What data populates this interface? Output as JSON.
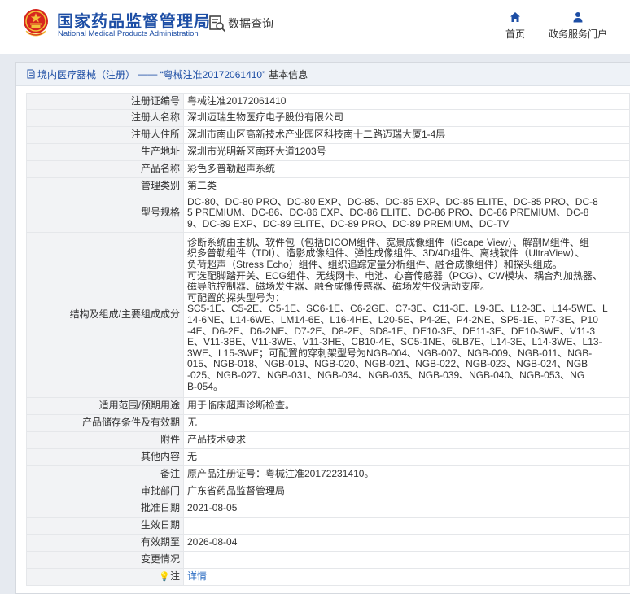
{
  "header": {
    "brand_cn": "国家药品监督管理局",
    "brand_en": "National Medical Products Administration",
    "data_query": "数据查询",
    "nav": [
      {
        "label": "首页",
        "icon": "home-icon"
      },
      {
        "label": "政务服务门户",
        "icon": "user-icon"
      }
    ]
  },
  "panel": {
    "breadcrumb_link": "境内医疗器械（注册）",
    "breadcrumb_sep": " —— ",
    "breadcrumb_item": "“粤械注准20172061410”",
    "breadcrumb_suffix": "基本信息"
  },
  "fields": {
    "reg_no": {
      "label": "注册证编号",
      "value": "粤械注准20172061410"
    },
    "registrant": {
      "label": "注册人名称",
      "value": "深圳迈瑞生物医疗电子股份有限公司"
    },
    "registrant_addr": {
      "label": "注册人住所",
      "value": "深圳市南山区高新技术产业园区科技南十二路迈瑞大厦1-4层"
    },
    "production_addr": {
      "label": "生产地址",
      "value": "深圳市光明新区南环大道1203号"
    },
    "product_name": {
      "label": "产品名称",
      "value": "彩色多普勒超声系统"
    },
    "mgmt_class": {
      "label": "管理类别",
      "value": "第二类"
    },
    "model_spec": {
      "label": "型号规格",
      "lines": [
        "DC-80、DC-80 PRO、DC-80 EXP、DC-85、DC-85 EXP、DC-85 ELITE、DC-85 PRO、DC-8",
        "5 PREMIUM、DC-86、DC-86 EXP、DC-86 ELITE、DC-86 PRO、DC-86 PREMIUM、DC-8",
        "9、DC-89 EXP、DC-89 ELITE、DC-89 PRO、DC-89 PREMIUM、DC-TV"
      ]
    },
    "structure": {
      "label": "结构及组成/主要组成成分",
      "lines": [
        "诊断系统由主机、软件包（包括DICOM组件、宽景成像组件（iScape View）、解剖M组件、组",
        "织多普勒组件（TDI）、造影成像组件、弹性成像组件、3D/4D组件、离线软件（UltraView）、",
        "负荷超声（Stress Echo）组件、组织追踪定量分析组件、融合成像组件）和探头组成。",
        "可选配脚踏开关、ECG组件、无线网卡、电池、心音传感器（PCG）、CW模块、耦合剂加热器、",
        "磁导航控制器、磁场发生器、融合成像传感器、磁场发生仪活动支座。",
        "可配置的探头型号为：",
        "SC5-1E、C5-2E、C5-1E、SC6-1E、C6-2GE、C7-3E、C11-3E、L9-3E、L12-3E、L14-5WE、L",
        "14-6NE、L14-6WE、LM14-6E、L16-4HE、L20-5E、P4-2E、P4-2NE、SP5-1E、P7-3E、P10",
        "-4E、D6-2E、D6-2NE、D7-2E、D8-2E、SD8-1E、DE10-3E、DE11-3E、DE10-3WE、V11-3",
        "E、V11-3BE、V11-3WE、V11-3HE、CB10-4E、SC5-1NE、6LB7E、L14-3E、L14-3WE、L13-",
        "3WE、L15-3WE；可配置的穿刺架型号为NGB-004、NGB-007、NGB-009、NGB-011、NGB-",
        "015、NGB-018、NGB-019、NGB-020、NGB-021、NGB-022、NGB-023、NGB-024、NGB",
        "-025、NGB-027、NGB-031、NGB-034、NGB-035、NGB-039、NGB-040、NGB-053、NG",
        "B-054。"
      ]
    },
    "scope": {
      "label": "适用范围/预期用途",
      "value": "用于临床超声诊断检查。"
    },
    "storage": {
      "label": "产品储存条件及有效期",
      "value": "无"
    },
    "attachment": {
      "label": "附件",
      "value": "产品技术要求"
    },
    "other": {
      "label": "其他内容",
      "value": "无"
    },
    "remark": {
      "label": "备注",
      "value": "原产品注册证号：粤械注准20172231410。"
    },
    "approval_dept": {
      "label": "审批部门",
      "value": "广东省药品监督管理局"
    },
    "approval_date": {
      "label": "批准日期",
      "value": "2021-08-05"
    },
    "effective_date": {
      "label": "生效日期",
      "value": ""
    },
    "expiry_date": {
      "label": "有效期至",
      "value": "2026-08-04"
    },
    "change_info": {
      "label": "变更情况",
      "value": ""
    },
    "note": {
      "label": "注",
      "value": "详情"
    }
  }
}
